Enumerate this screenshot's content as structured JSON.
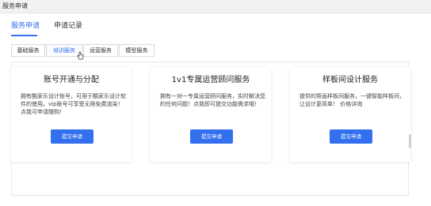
{
  "window": {
    "title": "服务申请"
  },
  "main_tabs": [
    {
      "label": "服务申请",
      "active": true
    },
    {
      "label": "申请记录",
      "active": false
    }
  ],
  "sub_tabs": [
    {
      "label": "基础服务",
      "active": false
    },
    {
      "label": "培训服务",
      "active": true
    },
    {
      "label": "运营服务",
      "active": false
    },
    {
      "label": "模型服务",
      "active": false
    }
  ],
  "cards": [
    {
      "title": "账号开通与分配",
      "desc_lines": [
        "拥有酷家乐设计账号，可用于酷家乐设计软",
        "件的使用。vip账号可享受无限免费渲染！",
        "点我可申请赠购！"
      ],
      "button": "提交申请"
    },
    {
      "title": "1v1专属运营顾问服务",
      "desc_lines": [
        "拥有一对一专属运营顾问服务，实时解决您",
        "的任何问题！点我即可提交功能需求哦！"
      ],
      "button": "提交申请"
    },
    {
      "title": "样板间设计服务",
      "desc_lines": [
        "提供的帮画样板间服务，一键智能样板间，",
        "让设计更简单！  价格详询"
      ],
      "button": "提交申请"
    }
  ],
  "colors": {
    "accent": "#3370f0",
    "border": "#d9d9d9"
  }
}
